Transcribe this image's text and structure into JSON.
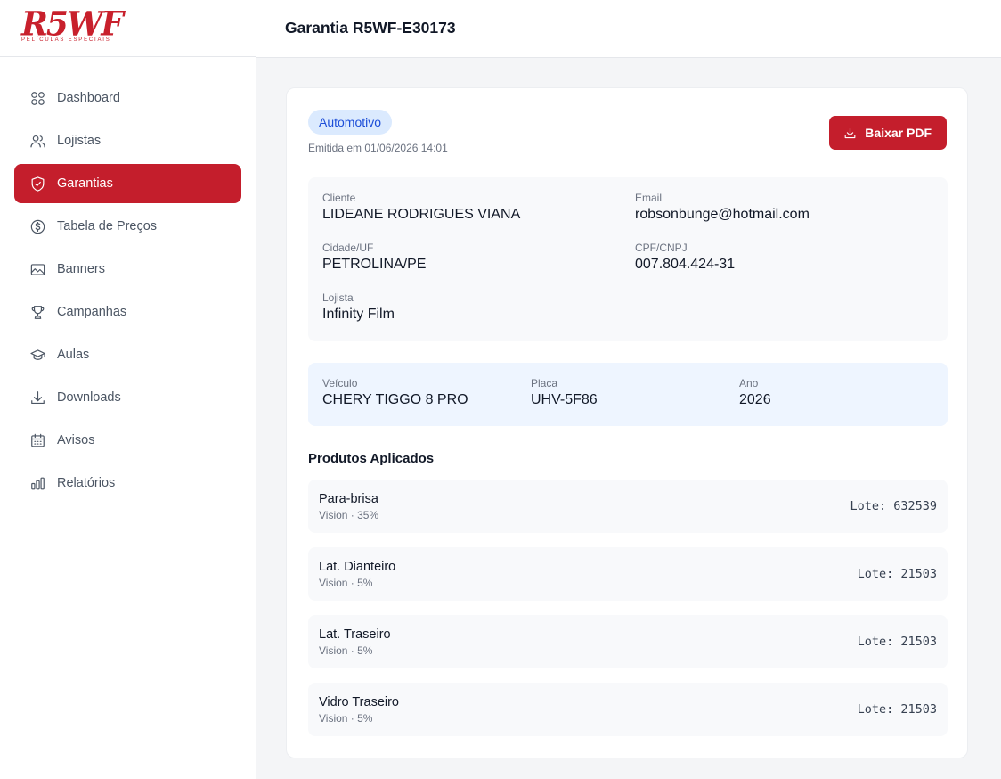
{
  "brand": {
    "logo_text": "R5WF",
    "logo_sub": "PELÍCULAS ESPECIAIS",
    "color": "#c41e2c"
  },
  "sidebar": {
    "items": [
      {
        "label": "Dashboard",
        "icon": "grid-icon",
        "active": false
      },
      {
        "label": "Lojistas",
        "icon": "users-icon",
        "active": false
      },
      {
        "label": "Garantias",
        "icon": "shield-check-icon",
        "active": true
      },
      {
        "label": "Tabela de Preços",
        "icon": "dollar-circle-icon",
        "active": false
      },
      {
        "label": "Banners",
        "icon": "image-icon",
        "active": false
      },
      {
        "label": "Campanhas",
        "icon": "trophy-icon",
        "active": false
      },
      {
        "label": "Aulas",
        "icon": "graduation-cap-icon",
        "active": false
      },
      {
        "label": "Downloads",
        "icon": "download-icon",
        "active": false
      },
      {
        "label": "Avisos",
        "icon": "calendar-icon",
        "active": false
      },
      {
        "label": "Relatórios",
        "icon": "bar-chart-icon",
        "active": false
      }
    ]
  },
  "header": {
    "title": "Garantia R5WF-E30173"
  },
  "warranty": {
    "category": "Automotivo",
    "emitted": "Emitida em 01/06/2026 14:01",
    "download_label": "Baixar PDF",
    "client": {
      "name_label": "Cliente",
      "name": "LIDEANE RODRIGUES VIANA",
      "email_label": "Email",
      "email": "robsonbunge@hotmail.com",
      "city_label": "Cidade/UF",
      "city": "PETROLINA/PE",
      "doc_label": "CPF/CNPJ",
      "doc": "007.804.424-31",
      "store_label": "Lojista",
      "store": "Infinity Film"
    },
    "vehicle": {
      "model_label": "Veículo",
      "model": "CHERY TIGGO 8 PRO",
      "plate_label": "Placa",
      "plate": "UHV-5F86",
      "year_label": "Ano",
      "year": "2026"
    },
    "products_title": "Produtos Aplicados",
    "products": [
      {
        "name": "Para-brisa",
        "desc": "Vision · 35%",
        "lote": "Lote: 632539"
      },
      {
        "name": "Lat. Dianteiro",
        "desc": "Vision · 5%",
        "lote": "Lote: 21503"
      },
      {
        "name": "Lat. Traseiro",
        "desc": "Vision · 5%",
        "lote": "Lote: 21503"
      },
      {
        "name": "Vidro Traseiro",
        "desc": "Vision · 5%",
        "lote": "Lote: 21503"
      }
    ]
  }
}
